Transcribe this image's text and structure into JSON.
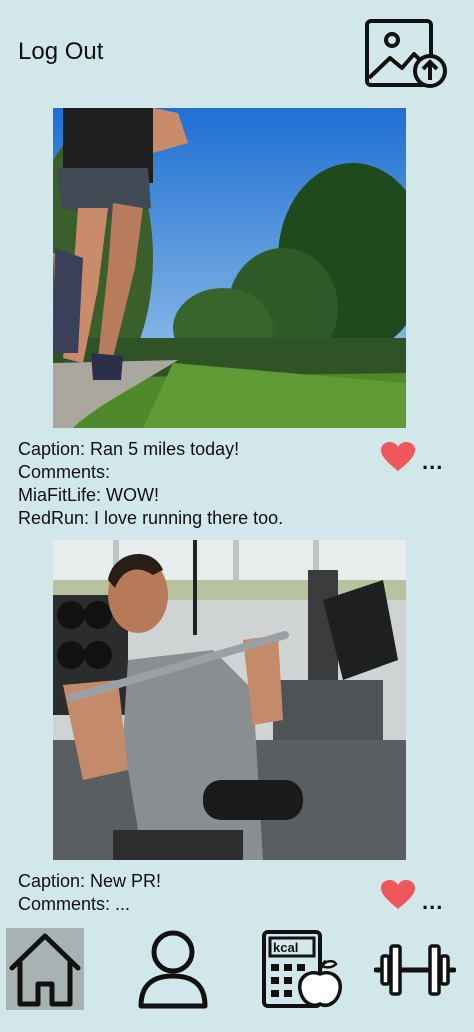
{
  "header": {
    "logout_label": "Log Out",
    "upload_icon": "image-upload-icon"
  },
  "posts": [
    {
      "image": "runner-on-trail-photo",
      "caption": "Caption: Ran 5 miles today!",
      "comments_label": "Comments:",
      "comments": [
        "MiaFitLife: WOW!",
        "RedRun: I love running there too."
      ],
      "like_icon": "heart-icon",
      "more_label": "..."
    },
    {
      "image": "gym-lat-pulldown-photo",
      "caption": "Caption: New PR!",
      "comments_label": "Comments: ...",
      "comments": [],
      "like_icon": "heart-icon",
      "more_label": "..."
    }
  ],
  "bottom_nav": {
    "items": [
      "home-icon",
      "profile-icon",
      "calorie-calculator-icon",
      "dumbbell-icon"
    ],
    "active": "home-icon",
    "calc_label": "kcal"
  },
  "colors": {
    "background": "#d2e7ea",
    "heart": "#f0575a",
    "active_nav": "#a7b2b2"
  }
}
